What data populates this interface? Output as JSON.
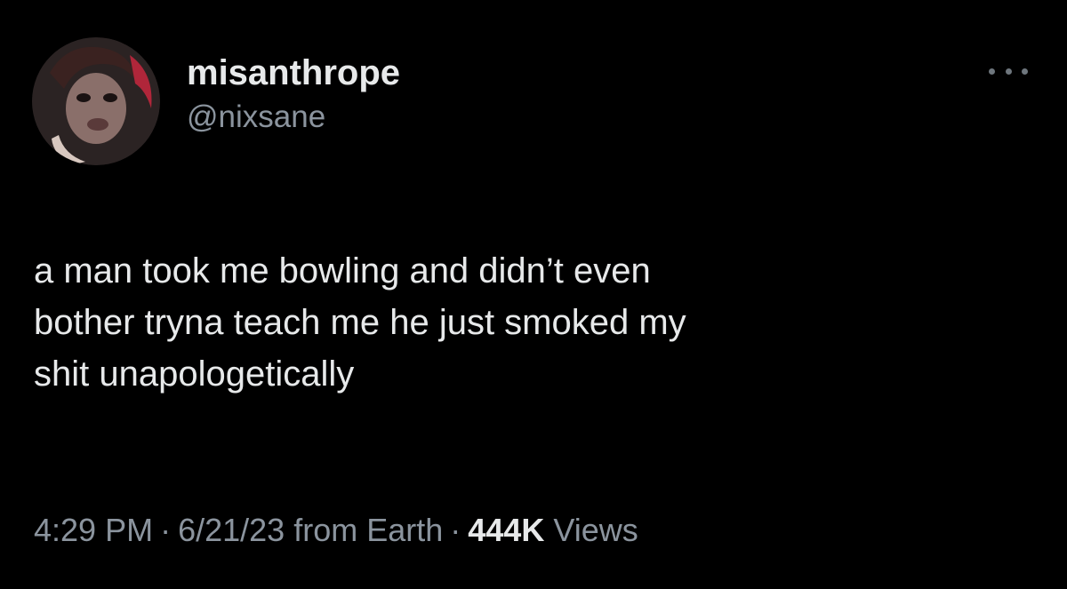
{
  "author": {
    "display_name": "misanthrope",
    "handle": "@nixsane"
  },
  "tweet": {
    "text_lines": [
      "a man took me bowling and didn’t even",
      "bother tryna teach me he just smoked my",
      "shit unapologetically"
    ]
  },
  "meta": {
    "time": "4:29 PM",
    "separator": "·",
    "date": "6/21/23",
    "source": "from Earth",
    "views_count": "444K",
    "views_label": "Views"
  },
  "icons": {
    "more": "more-horizontal-icon"
  },
  "colors": {
    "background": "#000000",
    "primary_text": "#e7e9ea",
    "secondary_text": "#8b949e"
  }
}
